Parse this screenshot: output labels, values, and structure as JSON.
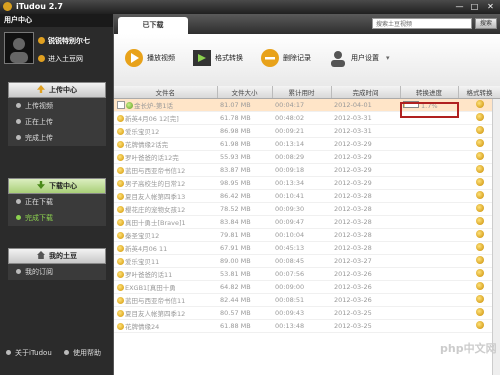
{
  "window": {
    "title": "iTudou 2.7",
    "min": "—",
    "max": "□",
    "close": "✕"
  },
  "sidebar": {
    "user_header": "用户中心",
    "username": "锐锐特别尔七",
    "enter_tudou": "进入土豆网",
    "upload": {
      "title": "上传中心",
      "items": [
        "上传视频",
        "正在上传",
        "完成上传"
      ]
    },
    "download": {
      "title": "下载中心",
      "items": [
        "正在下载",
        "完成下载"
      ],
      "selected": 1
    },
    "my_tudou": {
      "title": "我的土豆",
      "items": [
        "我的订阅"
      ]
    },
    "about": "关于iTudou",
    "help": "使用帮助"
  },
  "tabs": [
    "已下载"
  ],
  "search": {
    "placeholder": "搜索土豆视频",
    "button": "搜索"
  },
  "toolbar": {
    "play": "播放视频",
    "convert": "格式转换",
    "delete": "删除记录",
    "settings": "用户设置"
  },
  "columns": [
    "文件名",
    "文件大小",
    "累计用时",
    "完成时间",
    "转换进度",
    "格式转换"
  ],
  "rows": [
    {
      "name": "金长炉-第1话",
      "size": "81.07 MB",
      "time": "00:04:17",
      "date": "2012-04-01",
      "progress": "1.7%",
      "progress_value": 0.017
    },
    {
      "name": "新英4月06 12[完]",
      "size": "61.78 MB",
      "time": "00:48:02",
      "date": "2012-03-31"
    },
    {
      "name": "爱乐宝贝12",
      "size": "86.98 MB",
      "time": "00:09:21",
      "date": "2012-03-31"
    },
    {
      "name": "花牌情缘2话完",
      "size": "61.98 MB",
      "time": "00:13:14",
      "date": "2012-03-29"
    },
    {
      "name": "罗叶爸爸的话12完",
      "size": "55.93 MB",
      "time": "00:08:29",
      "date": "2012-03-29"
    },
    {
      "name": "蓝田与西亚帝书信12",
      "size": "83.87 MB",
      "time": "00:09:18",
      "date": "2012-03-29"
    },
    {
      "name": "男子高校生的日常12",
      "size": "98.95 MB",
      "time": "00:13:34",
      "date": "2012-03-29"
    },
    {
      "name": "夏目友人帐第四季13",
      "size": "86.42 MB",
      "time": "00:10:41",
      "date": "2012-03-28"
    },
    {
      "name": "樱花庄的宠物女孩12",
      "size": "78.52 MB",
      "time": "00:09:30",
      "date": "2012-03-28"
    },
    {
      "name": "真田十勇士[Brave]1",
      "size": "83.84 MB",
      "time": "00:09:47",
      "date": "2012-03-28"
    },
    {
      "name": "秦圣宝贝12",
      "size": "79.81 MB",
      "time": "00:10:04",
      "date": "2012-03-28"
    },
    {
      "name": "新英4月06 11",
      "size": "67.91 MB",
      "time": "00:45:13",
      "date": "2012-03-28"
    },
    {
      "name": "爱乐宝贝11",
      "size": "89.00 MB",
      "time": "00:08:45",
      "date": "2012-03-27"
    },
    {
      "name": "罗叶爸爸的话11",
      "size": "53.81 MB",
      "time": "00:07:56",
      "date": "2012-03-26"
    },
    {
      "name": "EXGB1[真田十勇",
      "size": "64.82 MB",
      "time": "00:09:00",
      "date": "2012-03-26"
    },
    {
      "name": "蓝田与西亚帝书信11",
      "size": "82.44 MB",
      "time": "00:08:51",
      "date": "2012-03-26"
    },
    {
      "name": "夏目友人帐第四季12",
      "size": "80.57 MB",
      "time": "00:09:43",
      "date": "2012-03-25"
    },
    {
      "name": "花牌情缘24",
      "size": "61.88 MB",
      "time": "00:13:48",
      "date": "2012-03-25"
    }
  ],
  "watermark": "php中文网"
}
